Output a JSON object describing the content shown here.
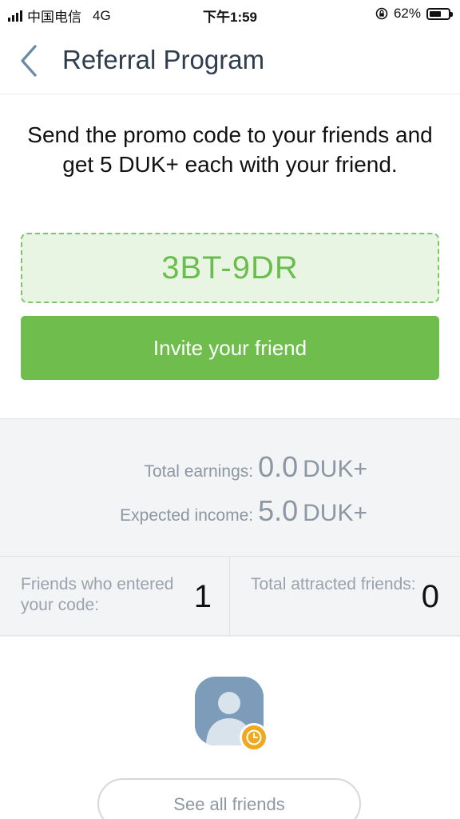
{
  "status_bar": {
    "carrier": "中国电信",
    "network": "4G",
    "time": "下午1:59",
    "battery": "62%",
    "battery_level": 0.62,
    "icons": [
      "signal-icon",
      "rotation-lock-icon",
      "battery-icon"
    ]
  },
  "nav": {
    "title": "Referral Program",
    "back_icon": "chevron-left-icon"
  },
  "promo": {
    "description": "Send the promo code to your friends and get 5 DUK+ each with your friend.",
    "code": "3BT-9DR",
    "invite_label": "Invite your friend"
  },
  "earnings": {
    "total_label": "Total earnings:",
    "total_value": "0.0",
    "total_unit": "DUK+",
    "expected_label": "Expected income:",
    "expected_value": "5.0",
    "expected_unit": "DUK+"
  },
  "friends": {
    "entered_label": "Friends who entered your code:",
    "entered_count": "1",
    "attracted_label": "Total attracted friends:",
    "attracted_count": "0"
  },
  "friends_list": {
    "avatar_icon": "user-avatar-icon",
    "badge_icon": "clock-icon",
    "see_all_label": "See all friends"
  },
  "colors": {
    "accent_green": "#6fbe4d",
    "code_green": "#6cbd4f",
    "badge_orange": "#f0a91f",
    "title_navy": "#2f3e4e",
    "muted_gray": "#8c97a3"
  }
}
